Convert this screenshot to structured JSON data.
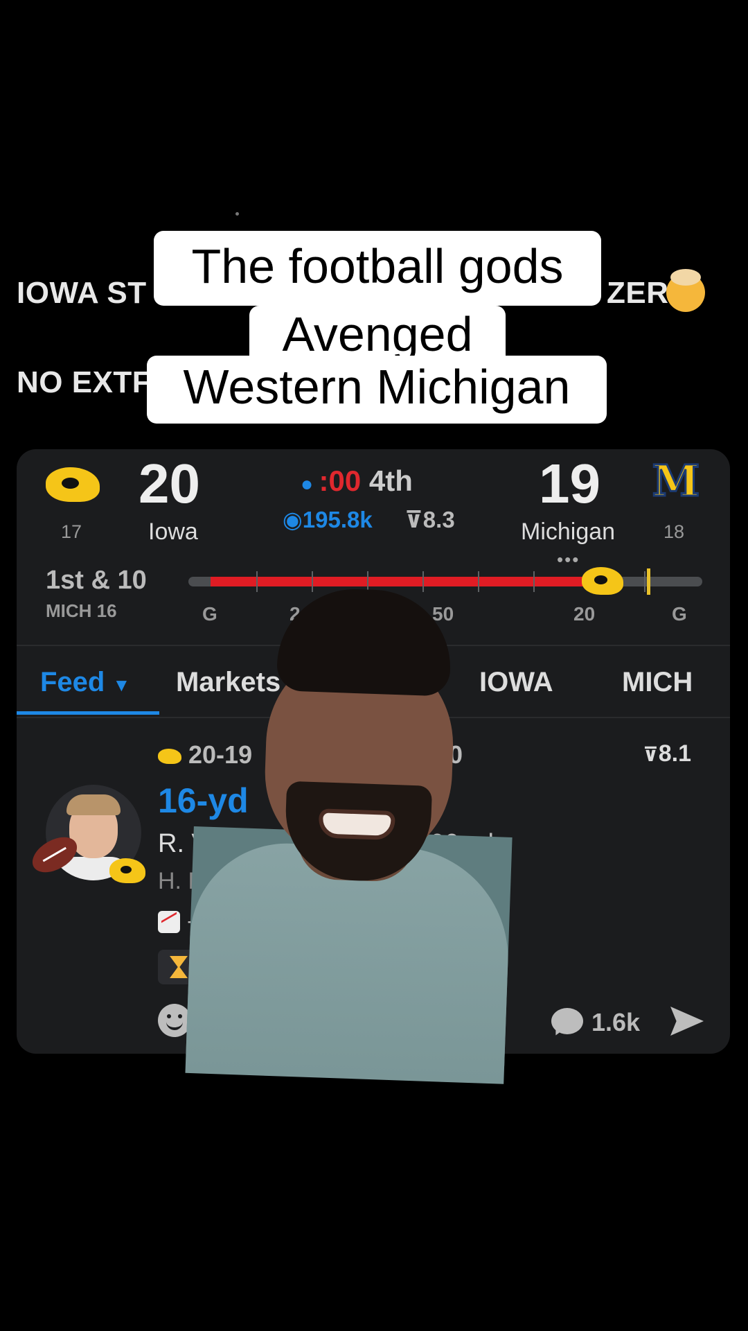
{
  "background_text": {
    "line1_left": "IOWA ST",
    "line1_right": "ZER",
    "line2_left": "NO EXTF"
  },
  "caption": {
    "line1": "The football gods",
    "line2": "Avenged",
    "line3": "Western Michigan"
  },
  "scoreboard": {
    "home": {
      "rank": "17",
      "score": "20",
      "name": "Iowa"
    },
    "away": {
      "rank": "18",
      "score": "19",
      "name": "Michigan"
    },
    "clock_time": ":00",
    "quarter": "4th",
    "viewers": "195.8k",
    "rating": "8.3",
    "down_distance": "1st & 10",
    "ball_spot": "MICH 16",
    "yard_labels": [
      "G",
      "2",
      "50",
      "20",
      "G"
    ]
  },
  "tabs": [
    "Feed",
    "Markets",
    "IOWA",
    "MICH"
  ],
  "play": {
    "score_line": "20-19",
    "score_line_tail": "0",
    "rating": "8.1",
    "title": "16-yd",
    "player_line": "R. Vande",
    "yardage_fragment": "66 yd",
    "holder_line": "H. Br",
    "trend_text": "+",
    "comments": "1.6k"
  },
  "colors": {
    "accent_blue": "#1e88e5",
    "field_red": "#e01c24",
    "hawkeye_gold": "#f5c518",
    "card_bg": "#1b1c1e"
  }
}
